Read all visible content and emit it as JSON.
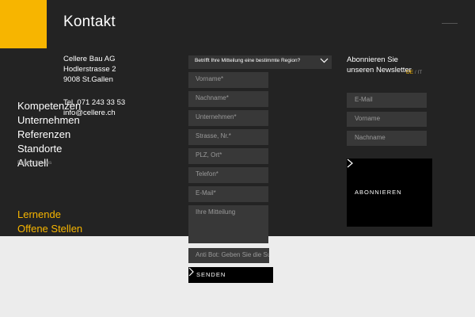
{
  "page": {
    "title": "Kontakt",
    "colors": {
      "dark_panel": "#232323",
      "accent": "#f7b500",
      "field": "#383838",
      "light_bg": "#ececec"
    }
  },
  "address": {
    "company": "Cellere Bau AG",
    "street": "Hodlerstrasse 2",
    "city": "9008 St.Gallen",
    "phone": "Tel. 071 243 33 53",
    "email": "info@cellere.ch"
  },
  "nav": {
    "items": [
      "Kompetenzen",
      "Unternehmen",
      "Referenzen",
      "Standorte",
      "Aktuell"
    ],
    "follow": "Folgen Sie uns",
    "accent_items": [
      "Lernende",
      "Offene Stellen"
    ]
  },
  "form": {
    "region_label": "Betrifft Ihre Mitteilung eine bestimmte Region?",
    "placeholders": {
      "vorname": "Vorname*",
      "nachname": "Nachname*",
      "unternehmen": "Unternehmen*",
      "strasse": "Strasse, Nr.*",
      "plz_ort": "PLZ, Ort*",
      "telefon": "Telefon*",
      "email": "E-Mail*",
      "mitteilung": "Ihre Mitteilung",
      "antibot": "Anti Bot: Geben Sie die Su"
    },
    "send_label": "SENDEN"
  },
  "newsletter": {
    "title_line1": "Abonnieren Sie",
    "title_line2": "unseren Newsletter",
    "lang_de": "DE",
    "lang_sep": "/",
    "lang_it": "IT",
    "placeholders": {
      "email": "E-Mail",
      "vorname": "Vorname",
      "nachname": "Nachname"
    },
    "subscribe_label": "ABONNIEREN"
  },
  "icons": {
    "region_chevron": "chevron-down-icon",
    "send_arrow": "chevron-right-icon",
    "subscribe_arrow": "chevron-right-icon",
    "menu": "menu-icon"
  }
}
